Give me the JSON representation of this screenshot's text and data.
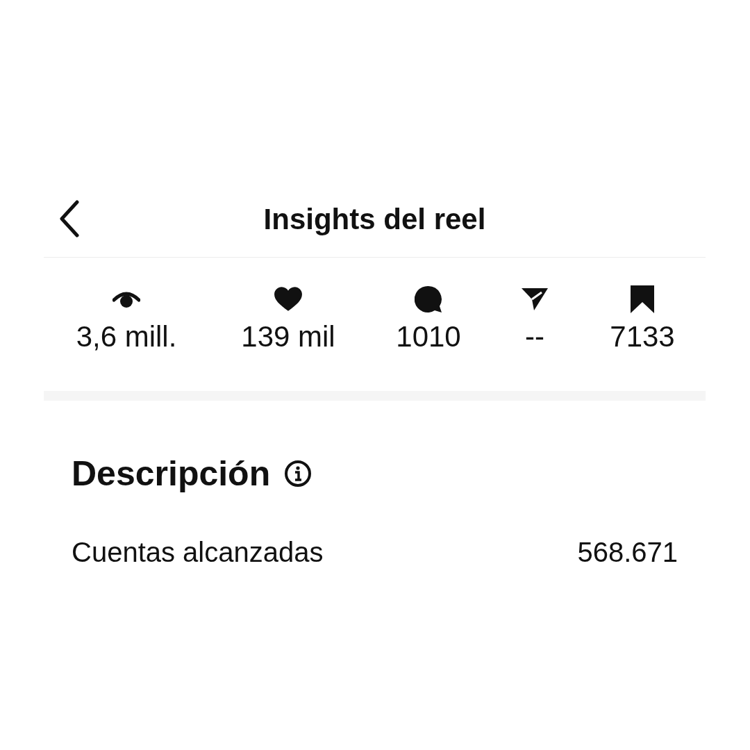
{
  "header": {
    "title": "Insights del reel"
  },
  "stats": [
    {
      "kind": "views",
      "value": "3,6 mill."
    },
    {
      "kind": "likes",
      "value": "139 mil"
    },
    {
      "kind": "comments",
      "value": "1010"
    },
    {
      "kind": "shares",
      "value": "--"
    },
    {
      "kind": "saves",
      "value": "7133"
    }
  ],
  "overview": {
    "title": "Descripción",
    "rows": [
      {
        "label": "Cuentas alcanzadas",
        "value": "568.671"
      }
    ]
  }
}
